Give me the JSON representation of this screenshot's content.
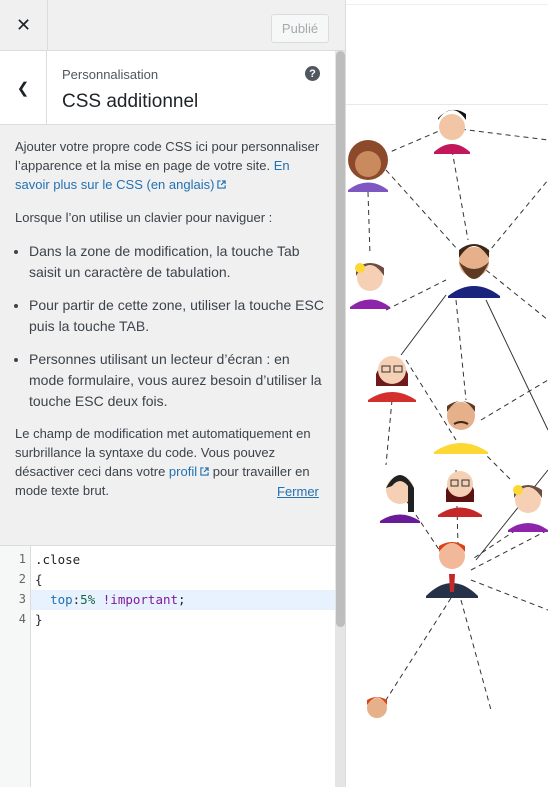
{
  "topbar": {
    "close_glyph": "✕",
    "publish_label": "Publié"
  },
  "section": {
    "breadcrumb": "Personnalisation",
    "title": "CSS additionnel",
    "back_glyph": "❮",
    "help_glyph": "?"
  },
  "description": {
    "intro": "Ajouter votre propre code CSS ici pour personnaliser l’apparence et la mise en page de votre site.",
    "learn_more_link": "En savoir plus sur le CSS (en anglais)",
    "keyboard_intro": "Lorsque l’on utilise un clavier pour naviguer :",
    "bullets": [
      "Dans la zone de modification, la touche Tab saisit un caractère de tabulation.",
      "Pour partir de cette zone, utiliser la touche ESC puis la touche TAB.",
      "Personnes utilisant un lecteur d’écran : en mode formulaire, vous aurez besoin d’utiliser la touche ESC deux fois."
    ],
    "highlight_text_before": "Le champ de modification met automatiquement en surbrillance la syntaxe du code. Vous pouvez désactiver ceci dans votre",
    "profile_link": "profil",
    "highlight_text_after": "pour travailler en mode texte brut.",
    "close_link": "Fermer"
  },
  "editor": {
    "line_numbers": [
      "1",
      "2",
      "3",
      "4"
    ],
    "lines": [
      ".close",
      "{",
      "  top:5% !important;",
      "}"
    ]
  },
  "icons": {
    "close": "close-icon",
    "back": "chevron-left-icon",
    "help": "help-icon",
    "external": "external-link-icon"
  },
  "colors": {
    "panel_bg": "#f0f0f1",
    "link": "#2271b1",
    "publish_disabled": "#a7aaad",
    "active_line": "#e8f2ff"
  }
}
